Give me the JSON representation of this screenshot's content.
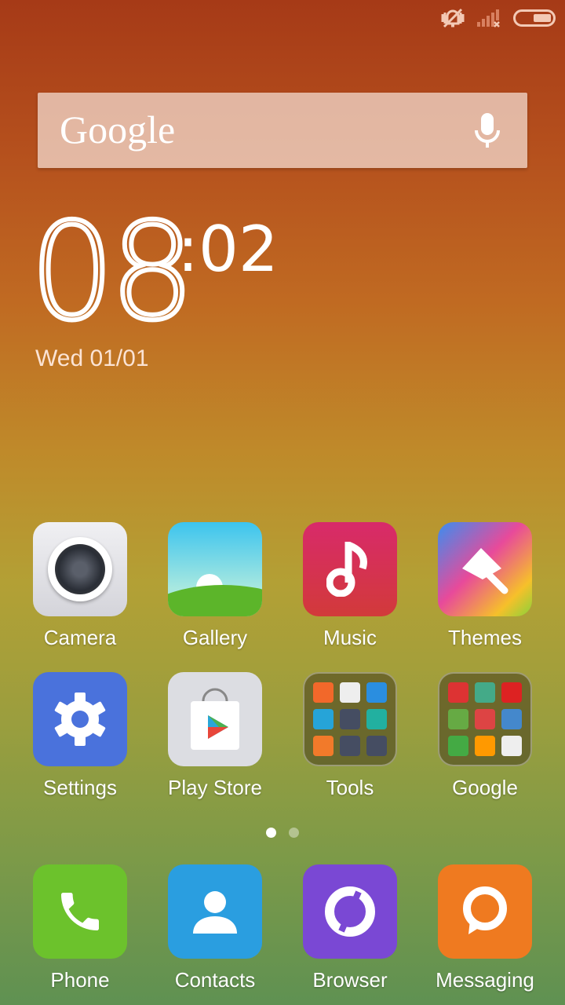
{
  "status_bar": {
    "icons": [
      "vibrate-off-icon",
      "signal-no-service-icon",
      "battery-icon"
    ],
    "battery_level": 0.45
  },
  "search": {
    "logo": "Google",
    "mic_icon": "mic-icon"
  },
  "clock": {
    "hours": "08",
    "minutes": ":02",
    "date": "Wed 01/01"
  },
  "apps": [
    {
      "label": "Camera",
      "icon": "camera-icon",
      "color": "#e2e2e6"
    },
    {
      "label": "Gallery",
      "icon": "gallery-icon",
      "color": "#4fc0e8"
    },
    {
      "label": "Music",
      "icon": "music-icon",
      "color": "#d42d5c"
    },
    {
      "label": "Themes",
      "icon": "brush-icon",
      "color": "#e85a8a"
    },
    {
      "label": "Settings",
      "icon": "gear-icon",
      "color": "#4a73d8"
    },
    {
      "label": "Play Store",
      "icon": "play-store-icon",
      "color": "#dcdde2"
    },
    {
      "label": "Tools",
      "icon": "folder-icon"
    },
    {
      "label": "Google",
      "icon": "folder-icon"
    }
  ],
  "tools_folder": [
    "#f2682a",
    "#eeeeee",
    "#2a8ee0",
    "#26a4d8",
    "#454d62",
    "#22b0a0",
    "#f27a2a",
    "#454d62",
    "#454d62"
  ],
  "google_folder": [
    "#d33",
    "#4a8",
    "#d22",
    "#6a4",
    "#d44",
    "#48c",
    "#4a4",
    "#f90",
    "#eee"
  ],
  "page_indicator": {
    "pages": 2,
    "current": 1
  },
  "dock": [
    {
      "label": "Phone",
      "icon": "phone-icon",
      "color": "#6cc22c"
    },
    {
      "label": "Contacts",
      "icon": "contacts-icon",
      "color": "#2a9ee0"
    },
    {
      "label": "Browser",
      "icon": "browser-icon",
      "color": "#7a48d4"
    },
    {
      "label": "Messaging",
      "icon": "message-icon",
      "color": "#ef7a20"
    }
  ]
}
